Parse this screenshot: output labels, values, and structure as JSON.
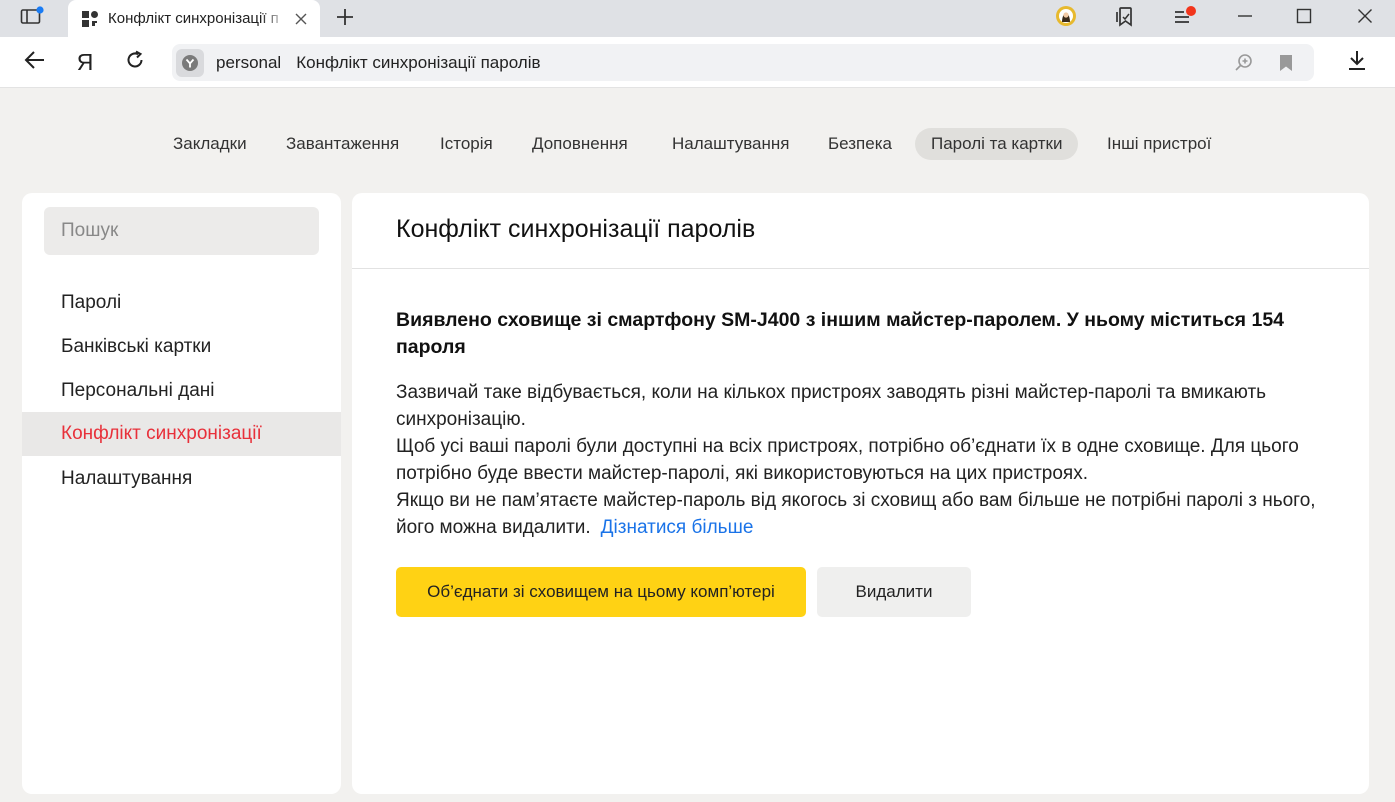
{
  "browser": {
    "tab_title": "Конфлікт синхронізації п",
    "address_host": "personal",
    "address_title": "Конфлікт синхронізації паролів",
    "yandex_logo": "Я"
  },
  "topnav": {
    "items": [
      "Закладки",
      "Завантаження",
      "Історія",
      "Доповнення",
      "Налаштування",
      "Безпека",
      "Паролі та картки",
      "Інші пристрої"
    ],
    "active": "Паролі та картки"
  },
  "sidebar": {
    "search_placeholder": "Пошук",
    "items": [
      "Паролі",
      "Банківські картки",
      "Персональні дані",
      "Конфлікт синхронізації",
      "Налаштування"
    ],
    "active": "Конфлікт синхронізації"
  },
  "main": {
    "title": "Конфлікт синхронізації паролів",
    "heading": "Виявлено сховище зі смартфону SM-J400 з іншим майстер-паролем. У ньому міститься 154 пароля",
    "paragraph1": "Зазвичай таке відбувається, коли на кількох пристроях заводять різні майстер-паролі та вмикають синхронізацію.",
    "paragraph2": "Щоб усі ваші паролі були доступні на всіх пристроях, потрібно об’єднати їх в одне сховище. Для цього потрібно буде ввести майстер-паролі, які використовуються на цих пристроях.",
    "paragraph3": "Якщо ви не пам’ятаєте майстер-пароль від якогось зі сховищ або вам більше не потрібні паролі з нього, його можна видалити.",
    "learn_more": "Дізнатися більше",
    "merge_button": "Об’єднати зі сховищем на цьому комп’ютері",
    "delete_button": "Видалити"
  },
  "colors": {
    "accent_red": "#e8303a",
    "primary_button": "#ffd214",
    "link": "#1a73e8",
    "notification_dot": "#f2351c"
  }
}
